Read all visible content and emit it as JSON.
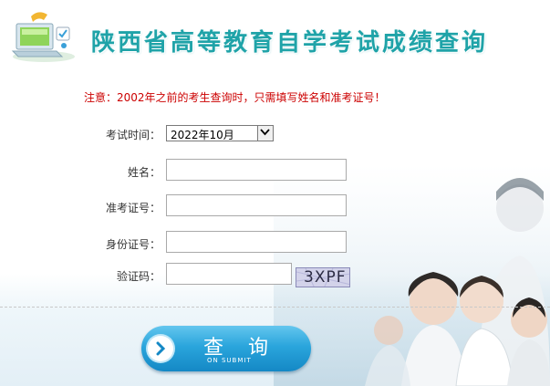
{
  "header": {
    "title": "陕西省高等教育自学考试成绩查询"
  },
  "notice": "注意：2002年之前的考生查询时，只需填写姓名和准考证号！",
  "form": {
    "exam_time": {
      "label": "考试时间：",
      "selected": "2022年10月"
    },
    "name": {
      "label": "姓名：",
      "value": ""
    },
    "ticket_no": {
      "label": "准考证号：",
      "value": ""
    },
    "id_no": {
      "label": "身份证号：",
      "value": ""
    },
    "captcha": {
      "label": "验证码：",
      "value": "",
      "image_text": "3XPF"
    }
  },
  "submit": {
    "label": "查 询",
    "sublabel": "ON SUBMIT"
  },
  "colors": {
    "title": "#1fa3a8",
    "notice": "#cc0000",
    "button": "#2aa5dc"
  },
  "icons": {
    "logo": "laptop-icon",
    "submit": "chevron-right-icon",
    "select": "chevron-down-icon"
  }
}
